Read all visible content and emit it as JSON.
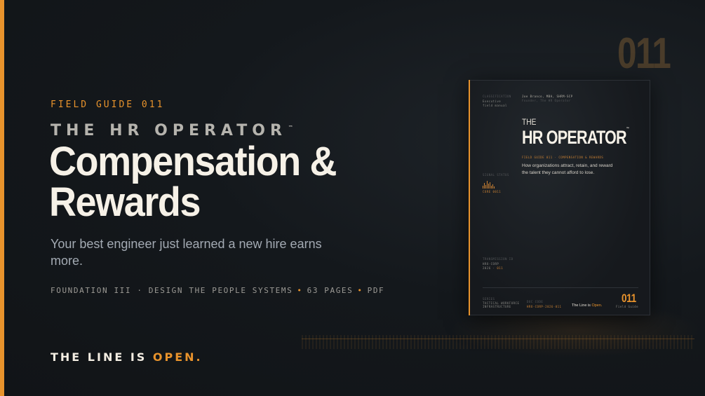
{
  "left": {
    "eyebrow": "FIELD GUIDE 011",
    "series": "THE HR OPERATOR",
    "series_mark": "™",
    "title_line1": "Compensation &",
    "title_line2": "Rewards",
    "subtitle": "Your best engineer just learned a new hire earns more.",
    "meta": {
      "foundation": "FOUNDATION III · DESIGN THE PEOPLE SYSTEMS",
      "pages": "63 PAGES",
      "format": "PDF",
      "separator": "•"
    },
    "tagline_prefix": "THE LINE IS",
    "tagline_open": "OPEN."
  },
  "big_number": "011",
  "cover": {
    "classification_label": "CLASSIFICATION",
    "classification_value_1": "Executive",
    "classification_value_2": "field manual",
    "author": "Joe Branco, MBA, SHRM-SCP",
    "author_role": "Founder, The HR Operator",
    "the": "THE",
    "title": "HR OPERATOR",
    "tm": "™",
    "guide_line": "FIELD GUIDE 011 · COMPENSATION & REWARDS",
    "description": "How organizations attract, retain, and reward the talent they cannot afford to lose.",
    "signal_label": "SIGNAL STATUS",
    "signal_value": "CORE 0011",
    "transmission_label": "TRANSMISSION ID",
    "transmission_1": "HRO-CORP",
    "transmission_2_prefix": "2026 ·",
    "transmission_2_suffix": "011",
    "series_label": "SERIES",
    "series_1": "TACTICAL WORKFORCE",
    "series_2": "INFRASTRUCTURE",
    "doc_label": "DOC CODE",
    "doc_value": "HRO-CORP-2026-011",
    "line_prefix": "The Line is",
    "line_open": "Open.",
    "number": "011",
    "number_sub": "Field Guide"
  },
  "colors": {
    "accent": "#e8932c",
    "background": "#14181c",
    "text": "#f3ede2",
    "muted": "#a3aab3"
  }
}
